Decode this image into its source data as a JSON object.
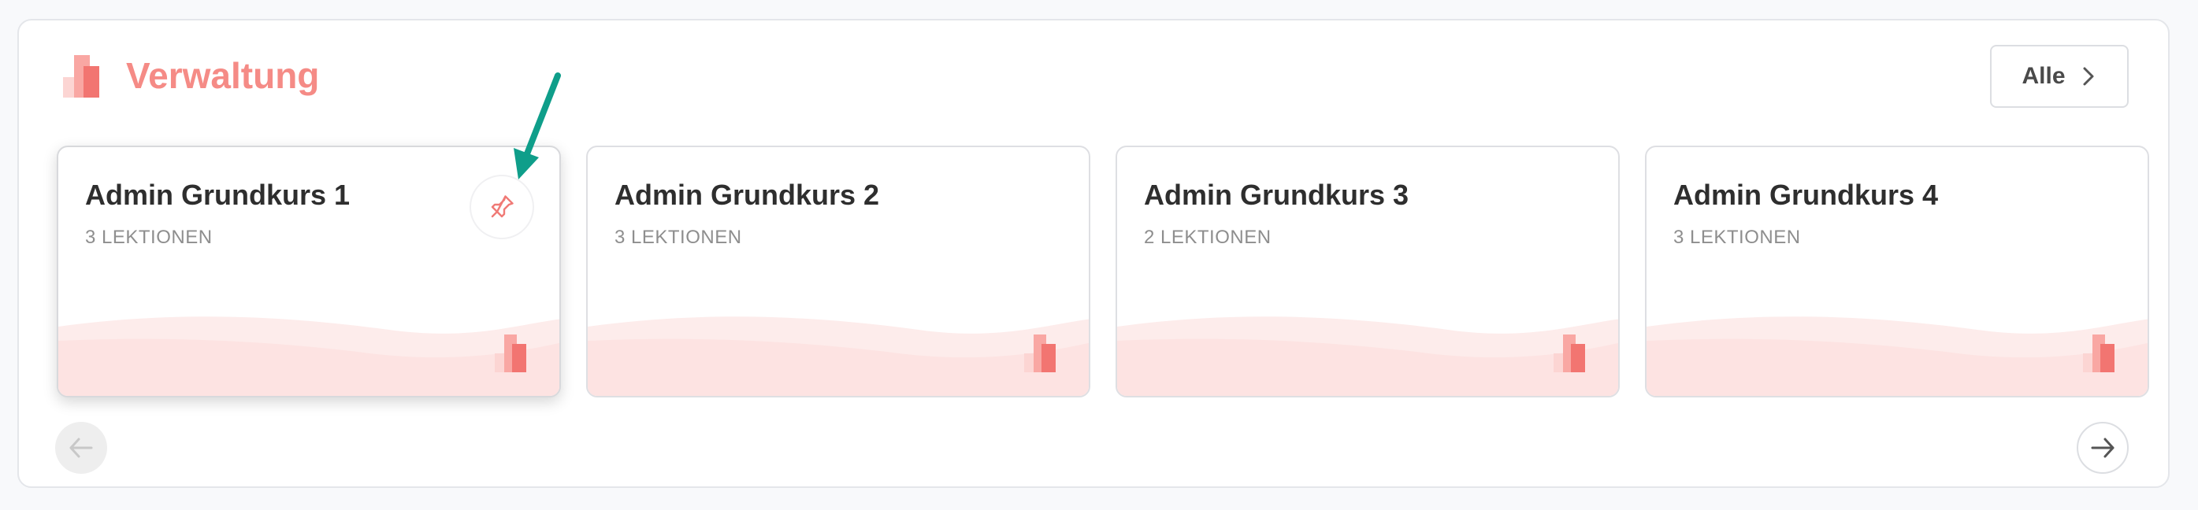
{
  "section": {
    "title": "Verwaltung",
    "accent_color": "#f58b86",
    "icon": "stacked-bars-icon"
  },
  "header": {
    "all_label": "Alle",
    "all_icon": "chevron-right-icon"
  },
  "courses": [
    {
      "title": "Admin Grundkurs 1",
      "lessons": "3 LEKTIONEN",
      "pinned_hover": true
    },
    {
      "title": "Admin Grundkurs 2",
      "lessons": "3 LEKTIONEN",
      "pinned_hover": false
    },
    {
      "title": "Admin Grundkurs 3",
      "lessons": "2 LEKTIONEN",
      "pinned_hover": false
    },
    {
      "title": "Admin Grundkurs 4",
      "lessons": "3 LEKTIONEN",
      "pinned_hover": false
    }
  ],
  "pin": {
    "icon": "pin-icon",
    "color": "#f07a76"
  },
  "annotation": {
    "icon": "arrow-annotation-icon",
    "color": "#0f9e8a"
  },
  "carousel": {
    "prev_icon": "arrow-left-icon",
    "next_icon": "arrow-right-icon"
  }
}
